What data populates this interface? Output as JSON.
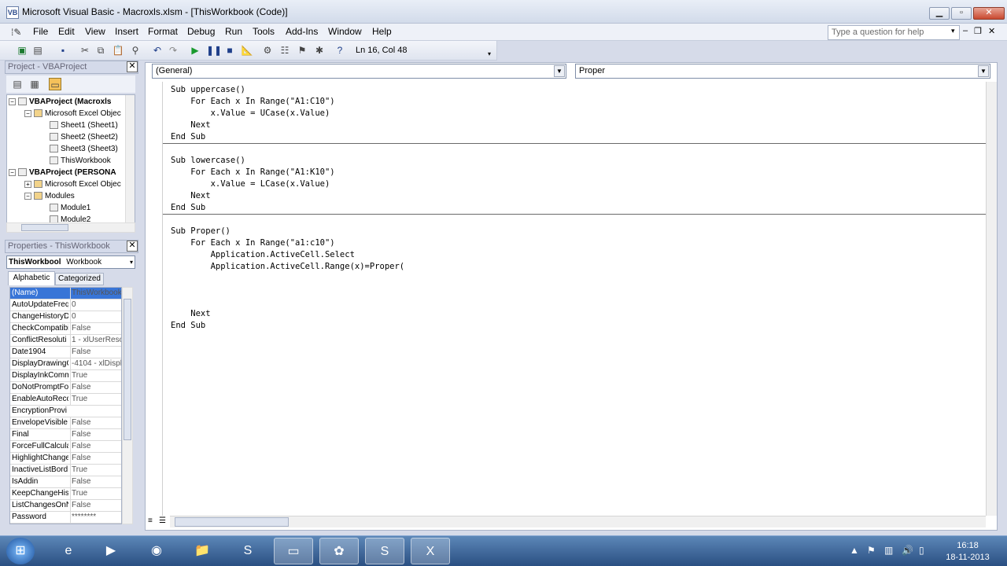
{
  "window": {
    "title": "Microsoft Visual Basic - Macroxls.xlsm - [ThisWorkbook (Code)]"
  },
  "menu": {
    "items": [
      "File",
      "Edit",
      "View",
      "Insert",
      "Format",
      "Debug",
      "Run",
      "Tools",
      "Add-Ins",
      "Window",
      "Help"
    ]
  },
  "help_placeholder": "Type a question for help",
  "toolbar": {
    "position": "Ln 16, Col 48"
  },
  "project_pane": {
    "title": "Project - VBAProject",
    "tree": [
      {
        "label": "VBAProject (Macroxls",
        "bold": true
      },
      {
        "label": "Microsoft Excel Objec",
        "bold": false
      },
      {
        "label": "Sheet1 (Sheet1)",
        "bold": false
      },
      {
        "label": "Sheet2 (Sheet2)",
        "bold": false
      },
      {
        "label": "Sheet3 (Sheet3)",
        "bold": false
      },
      {
        "label": "ThisWorkbook",
        "bold": false
      },
      {
        "label": "VBAProject (PERSONA",
        "bold": true
      },
      {
        "label": "Microsoft Excel Objec",
        "bold": false
      },
      {
        "label": "Modules",
        "bold": false
      },
      {
        "label": "Module1",
        "bold": false
      },
      {
        "label": "Module2",
        "bold": false
      }
    ]
  },
  "properties_pane": {
    "title": "Properties - ThisWorkbook",
    "object_name": "ThisWorkbool",
    "object_type": "Workbook",
    "tabs": [
      "Alphabetic",
      "Categorized"
    ],
    "rows": [
      {
        "k": "(Name)",
        "v": "ThisWorkbook"
      },
      {
        "k": "AutoUpdateFreq",
        "v": "0"
      },
      {
        "k": "ChangeHistoryD",
        "v": "0"
      },
      {
        "k": "CheckCompatibi",
        "v": "False"
      },
      {
        "k": "ConflictResoluti",
        "v": "1 - xlUserReso"
      },
      {
        "k": "Date1904",
        "v": "False"
      },
      {
        "k": "DisplayDrawingO",
        "v": "-4104 - xlDispla"
      },
      {
        "k": "DisplayInkComm",
        "v": "True"
      },
      {
        "k": "DoNotPromptFo",
        "v": "False"
      },
      {
        "k": "EnableAutoRecc",
        "v": "True"
      },
      {
        "k": "EncryptionProvi",
        "v": ""
      },
      {
        "k": "EnvelopeVisible",
        "v": "False"
      },
      {
        "k": "Final",
        "v": "False"
      },
      {
        "k": "ForceFullCalcula",
        "v": "False"
      },
      {
        "k": "HighlightChange",
        "v": "False"
      },
      {
        "k": "InactiveListBord",
        "v": "True"
      },
      {
        "k": "IsAddin",
        "v": "False"
      },
      {
        "k": "KeepChangeHis",
        "v": "True"
      },
      {
        "k": "ListChangesOnN",
        "v": "False"
      },
      {
        "k": "Password",
        "v": "********"
      }
    ]
  },
  "code_pane": {
    "object_combo": "(General)",
    "proc_combo": "Proper",
    "lines": [
      "Sub uppercase()",
      "    For Each x In Range(\"A1:C10\")",
      "        x.Value = UCase(x.Value)",
      "    Next",
      "End Sub",
      "Sub lowercase()",
      "    For Each x In Range(\"A1:K10\")",
      "        x.Value = LCase(x.Value)",
      "    Next",
      "End Sub",
      "Sub Proper()",
      "    For Each x In Range(\"a1:c10\")",
      "        Application.ActiveCell.Select",
      "        Application.ActiveCell.Range(x)=Proper(",
      "    Next",
      "End Sub"
    ]
  },
  "taskbar": {
    "time": "16:18",
    "date": "18-11-2013"
  }
}
